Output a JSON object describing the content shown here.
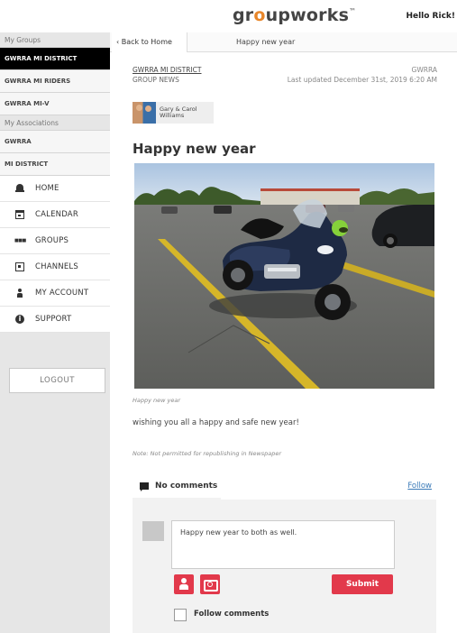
{
  "header": {
    "logo_pre": "gr",
    "logo_o": "o",
    "logo_post": "upworks",
    "logo_tm": "™",
    "greeting": "Hello Rick!"
  },
  "sidebar": {
    "my_groups_label": "My Groups",
    "groups": [
      {
        "label": "GWRRA MI DISTRICT",
        "active": true
      },
      {
        "label": "GWRRA MI RIDERS",
        "active": false
      },
      {
        "label": "GWRRA MI-V",
        "active": false
      }
    ],
    "my_associations_label": "My Associations",
    "associations": [
      {
        "label": "GWRRA"
      },
      {
        "label": "MI DISTRICT"
      }
    ],
    "nav": [
      {
        "label": "HOME",
        "icon": "home-icon"
      },
      {
        "label": "CALENDAR",
        "icon": "calendar-icon"
      },
      {
        "label": "GROUPS",
        "icon": "groups-icon"
      },
      {
        "label": "CHANNELS",
        "icon": "channels-icon"
      },
      {
        "label": "MY ACCOUNT",
        "icon": "account-icon"
      },
      {
        "label": "SUPPORT",
        "icon": "info-icon"
      }
    ],
    "logout_label": "LOGOUT"
  },
  "topbar": {
    "back_label": "Back to Home",
    "title": "Happy new year"
  },
  "post": {
    "group_name": "GWRRA MI DISTRICT",
    "group_type": "GROUP NEWS",
    "association": "GWRRA",
    "updated": "Last updated December 31st, 2019 6:20 AM",
    "author_line1": "Gary & Carol",
    "author_line2": "Williams",
    "title": "Happy new year",
    "image_caption": "Happy new year",
    "body": "wishing you all a happy and safe new year!",
    "note": "Note: Not permitted for republishing in Newspaper"
  },
  "comments": {
    "count_label": "No comments",
    "follow_label": "Follow",
    "input_value": "Happy new year to both as well.",
    "submit_label": "Submit",
    "follow_comments_label": "Follow comments"
  },
  "colors": {
    "accent_red": "#e2394b",
    "logo_orange": "#e8862a",
    "link_blue": "#3a7ab8"
  }
}
